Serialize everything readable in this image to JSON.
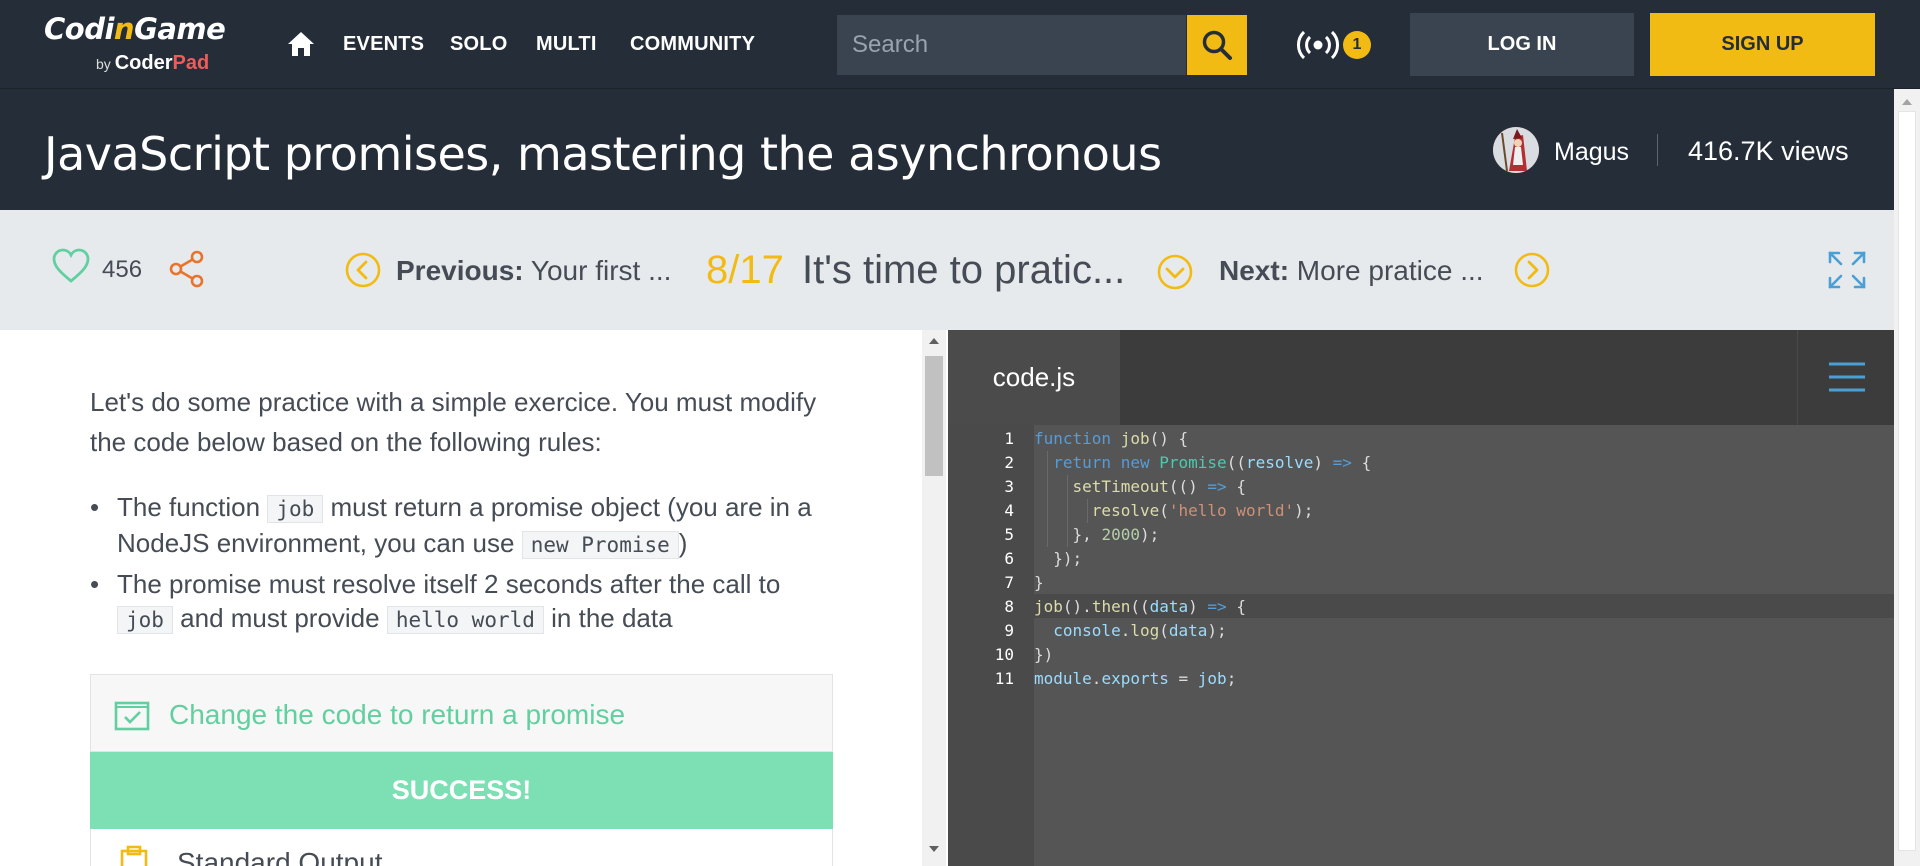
{
  "nav": {
    "logo_main_a": "Codi",
    "logo_main_b": "n",
    "logo_main_c": "Game",
    "logo_by": "by ",
    "logo_coder": "Coder",
    "logo_pad": "Pad",
    "items": [
      {
        "label": "EVENTS"
      },
      {
        "label": "SOLO"
      },
      {
        "label": "MULTI"
      },
      {
        "label": "COMMUNITY"
      }
    ],
    "search_placeholder": "Search",
    "notification_count": "1",
    "login_label": "LOG IN",
    "signup_label": "SIGN UP"
  },
  "header": {
    "title": "JavaScript promises, mastering the asynchronous",
    "author": "Magus",
    "views": "416.7K views"
  },
  "toolbar": {
    "likes": "456",
    "previous_label": "Previous:",
    "previous_title": " Your first ...",
    "progress": "8/17",
    "chapter_title": "It's time to pratic...",
    "next_label": "Next:",
    "next_title": " More pratice ..."
  },
  "lesson": {
    "intro": "Let's do some practice with a simple exercice. You must modify the code below based on the following rules:",
    "rule1_a": "The function ",
    "rule1_code1": "job",
    "rule1_b": " must return a promise object (you are in a NodeJS environment, you can use ",
    "rule1_code2": "new Promise",
    "rule1_c": ")",
    "rule2_a": "The promise must resolve itself 2 seconds after the call to ",
    "rule2_code1": "job",
    "rule2_b": " and must provide ",
    "rule2_code2": "hello world",
    "rule2_c": " in the data",
    "test_label": "Change the code to return a promise",
    "success_label": "SUCCESS!",
    "stdout_label": "Standard Output"
  },
  "editor": {
    "file_tab": "code.js",
    "line_numbers": [
      "1",
      "2",
      "3",
      "4",
      "5",
      "6",
      "7",
      "8",
      "9",
      "10",
      "11"
    ],
    "code": {
      "l1_kw": "function",
      "l1_fn": "job",
      "l1_rest": "() {",
      "l2_kw1": "return",
      "l2_kw2": "new",
      "l2_tp": "Promise",
      "l2_p1": "((",
      "l2_pm": "resolve",
      "l2_p2": ")",
      "l2_arrow": "=>",
      "l2_p3": "{",
      "l3_fn": "setTimeout",
      "l3_p1": "(()",
      "l3_arrow": "=>",
      "l3_p2": "{",
      "l4_fn": "resolve",
      "l4_p1": "(",
      "l4_st": "'hello world'",
      "l4_p2": ");",
      "l5_p1": "},",
      "l5_nm": "2000",
      "l5_p2": ");",
      "l6": "});",
      "l7": "}",
      "l8_fn1": "job",
      "l8_p1": "().",
      "l8_fn2": "then",
      "l8_p2": "((",
      "l8_pm": "data",
      "l8_p3": ")",
      "l8_arrow": "=>",
      "l8_p4": "{",
      "l9_pm": "console",
      "l9_p1": ".",
      "l9_fn": "log",
      "l9_p2": "(",
      "l9_pm2": "data",
      "l9_p3": ");",
      "l10": "})",
      "l11_pm1": "module",
      "l11_p1": ".",
      "l11_pm2": "exports",
      "l11_p2": " = ",
      "l11_pm3": "job",
      "l11_p3": ";"
    }
  },
  "colors": {
    "nav_bg": "#252e38",
    "accent_yellow": "#f2bb13",
    "success_green": "#7ddfb4",
    "test_green": "#61cf9f",
    "toolbar_bg": "#e7eaed",
    "editor_bg": "#555555"
  },
  "icons": {
    "home": "home-icon",
    "search": "search-icon",
    "broadcast": "broadcast-icon",
    "heart": "heart-icon",
    "share": "share-icon",
    "previous": "chevron-left-circle-icon",
    "chapters": "chevron-down-circle-icon",
    "next": "chevron-right-circle-icon",
    "fullscreen": "expand-icon",
    "menu": "hamburger-menu-icon",
    "test": "checkbox-checked-icon",
    "stdout": "clipboard-icon"
  }
}
